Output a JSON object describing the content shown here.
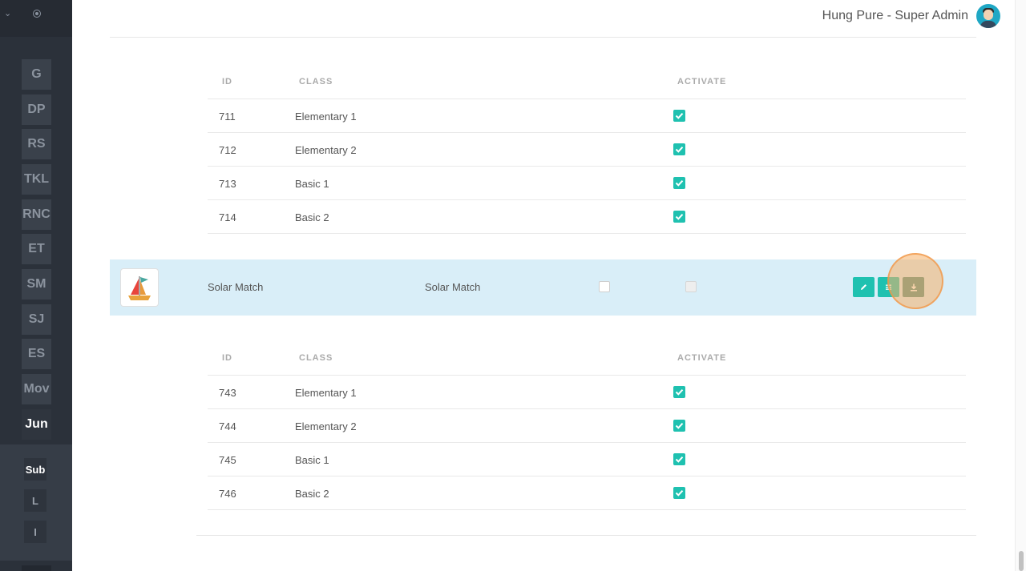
{
  "sidebar": {
    "items": [
      {
        "label": "G",
        "active": false
      },
      {
        "label": "DP",
        "active": false
      },
      {
        "label": "RS",
        "active": false
      },
      {
        "label": "TKL",
        "active": false
      },
      {
        "label": "RNC",
        "active": false
      },
      {
        "label": "ET",
        "active": false
      },
      {
        "label": "SM",
        "active": false
      },
      {
        "label": "SJ",
        "active": false
      },
      {
        "label": "ES",
        "active": false
      },
      {
        "label": "Mov",
        "active": false
      },
      {
        "label": "Jun",
        "active": true
      }
    ],
    "sub_items": [
      {
        "label": "Sub",
        "active": true
      },
      {
        "label": "L",
        "active": false
      },
      {
        "label": "I",
        "active": false
      }
    ]
  },
  "header": {
    "user_label": "Hung Pure - Super Admin"
  },
  "table_columns": {
    "id": "ID",
    "class": "CLASS",
    "activate": "ACTIVATE"
  },
  "upper_table": {
    "rows": [
      {
        "id": "711",
        "class": "Elementary 1",
        "activated": true
      },
      {
        "id": "712",
        "class": "Elementary 2",
        "activated": true
      },
      {
        "id": "713",
        "class": "Basic 1",
        "activated": true
      },
      {
        "id": "714",
        "class": "Basic 2",
        "activated": true
      }
    ]
  },
  "game_row": {
    "name": "Solar Match",
    "class_name": "Solar Match",
    "checkbox_1_checked": false,
    "checkbox_2_checked": false,
    "actions": [
      "edit-icon",
      "list-icon",
      "download-icon"
    ]
  },
  "lower_table": {
    "rows": [
      {
        "id": "743",
        "class": "Elementary 1",
        "activated": true
      },
      {
        "id": "744",
        "class": "Elementary 2",
        "activated": true
      },
      {
        "id": "745",
        "class": "Basic 1",
        "activated": true
      },
      {
        "id": "746",
        "class": "Basic 2",
        "activated": true
      }
    ]
  },
  "colors": {
    "accent": "#1fc1b0",
    "sidebar": "#2b313a",
    "row_highlight": "#d9eef8",
    "click_ring": "#f6b068"
  }
}
